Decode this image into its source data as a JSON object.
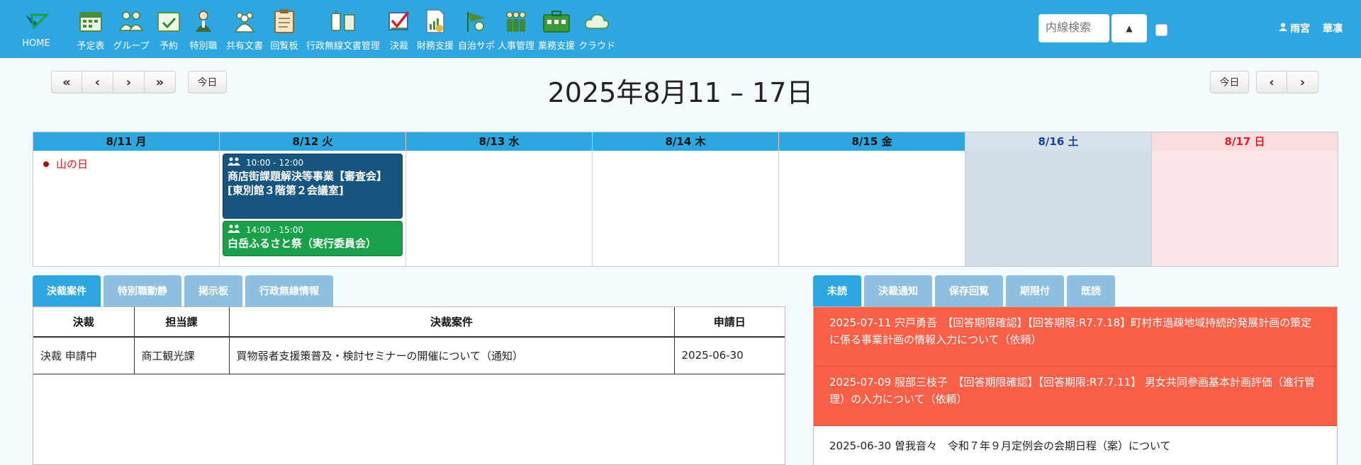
{
  "nav": {
    "home": "HOME",
    "items": [
      "予定表",
      "グループ",
      "予約",
      "特別職",
      "共有文書",
      "回覧板",
      "行政無線文書管理",
      "決裁",
      "財務支援",
      "自治サポ",
      "人事管理",
      "業務支援",
      "クラウド"
    ]
  },
  "header": {
    "search_placeholder": "内線検索",
    "user_surname": "雨宮",
    "user_given": "華凛"
  },
  "toolbar": {
    "first": "«",
    "prev": "‹",
    "next": "›",
    "last": "»",
    "today": "今日"
  },
  "calendar": {
    "title": "2025年8月11 – 17日",
    "days": [
      "8/11 月",
      "8/12 火",
      "8/13 水",
      "8/14 木",
      "8/15 金",
      "8/16 土",
      "8/17 日"
    ],
    "holiday": "山の日",
    "events": [
      {
        "time": "10:00 - 12:00",
        "title": "商店街課題解決等事業【審査会】[東別館３階第２会議室]"
      },
      {
        "time": "14:00 - 15:00",
        "title": "白岳ふるさと祭（実行委員会）"
      }
    ]
  },
  "left_tabs": [
    "決裁案件",
    "特別職動静",
    "掲示板",
    "行政無線情報"
  ],
  "right_tabs": [
    "未読",
    "決裁通知",
    "保存回覧",
    "期限付",
    "既読"
  ],
  "approval_table": {
    "headers": [
      "決裁",
      "担当課",
      "決裁案件",
      "申請日"
    ],
    "rows": [
      [
        "決裁 申請中",
        "商工観光課",
        "買物弱者支援策普及・検討セミナーの開催について（通知）",
        "2025-06-30"
      ]
    ]
  },
  "notices": [
    "2025-07-11 宍戸勇吾　【回答期限確認】【回答期限:R7.7.18】町村市過疎地域持続的発展計画の策定に係る事業計画の情報入力について（依頼）",
    "2025-07-09 服部三枝子　【回答期限確認】【回答期限:R7.7.11】 男女共同参画基本計画評価（進行管理）の入力について（依頼）",
    "2025-06-30 曽我音々　令和７年９月定例会の会期日程（案）について"
  ],
  "colors": {
    "accent": "#2ea6df",
    "tab_inactive": "#8fbfdf",
    "event_meeting": "#17557f",
    "event_festival": "#1aa048",
    "notice_urgent": "#fa6048",
    "holiday": "#c41a1a",
    "saturday": "#1540a0",
    "sunday": "#d8202a"
  }
}
